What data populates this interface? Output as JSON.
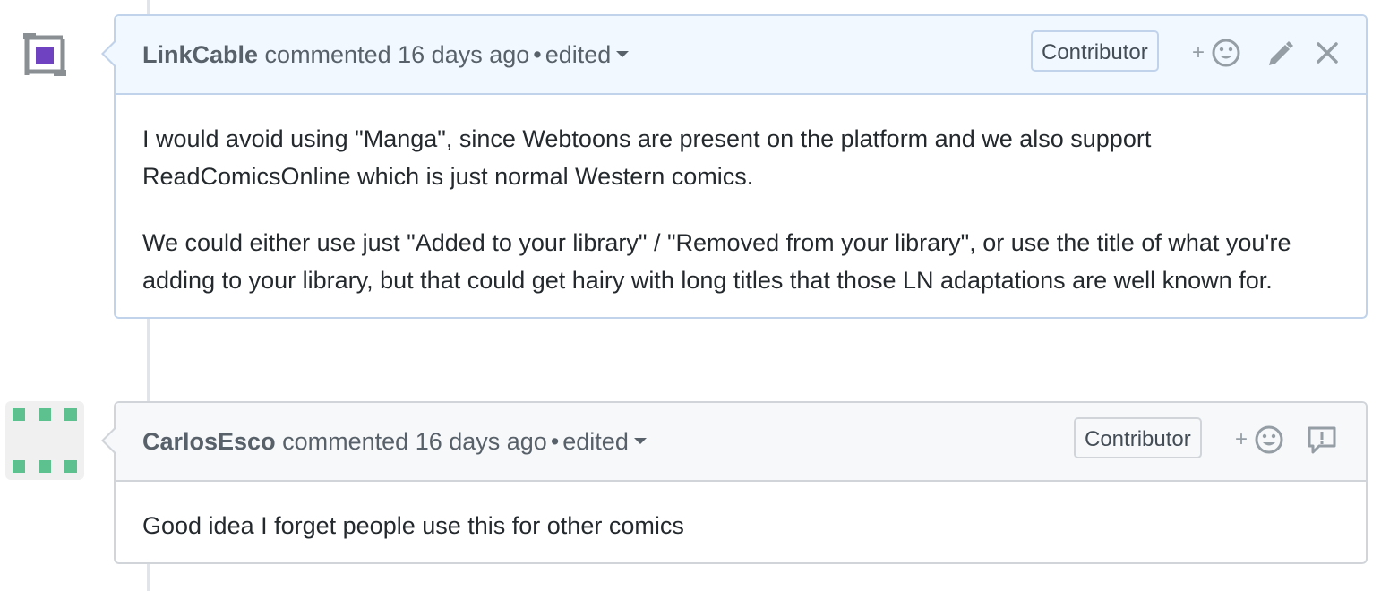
{
  "comments": [
    {
      "author": "LinkCable",
      "action": "commented",
      "time": "16 days ago",
      "separator": "•",
      "edited_label": "edited",
      "badge": "Contributor",
      "reaction_plus": "+",
      "icons": [
        "plus-icon",
        "smiley-icon",
        "pencil-icon",
        "close-icon"
      ],
      "body": [
        "I would avoid using \"Manga\", since Webtoons are present on the platform and we also support ReadComicsOnline which is just normal Western comics.",
        "We could either use just \"Added to your library\" / \"Removed from your library\", or use the title of what you're adding to your library, but that could get hairy with long titles that those LN adaptations are well known for."
      ],
      "avatar_colors": {
        "block": "#6f42c1",
        "frame": "#8a8f94"
      }
    },
    {
      "author": "CarlosEsco",
      "action": "commented",
      "time": "16 days ago",
      "separator": "•",
      "edited_label": "edited",
      "badge": "Contributor",
      "reaction_plus": "+",
      "icons": [
        "plus-icon",
        "smiley-icon",
        "report-icon"
      ],
      "body": [
        "Good idea I forget people use this for other comics"
      ],
      "avatar_colors": {
        "block": "#5cc08f",
        "background": "#f0f0f0"
      }
    }
  ],
  "colors": {
    "header_current_bg": "#f1f8ff",
    "header_bg": "#f6f8fa",
    "border_current": "#c0d3eb",
    "border": "#d1d5da",
    "muted_text": "#586069",
    "icon_gray": "#959da5"
  }
}
